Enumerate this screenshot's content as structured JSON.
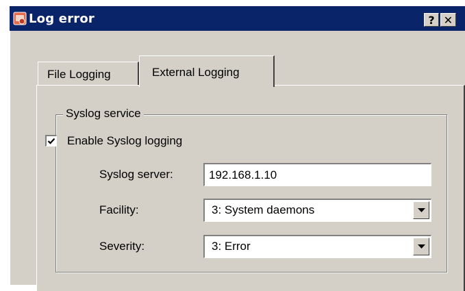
{
  "window": {
    "title": "Log error",
    "help_label": "?",
    "close_label": "✕"
  },
  "tabs": [
    {
      "label": "File Logging",
      "active": false
    },
    {
      "label": "External Logging",
      "active": true
    }
  ],
  "syslog": {
    "group_label": "Syslog service",
    "enable_label": "Enable Syslog logging",
    "enable_checked": true,
    "server_label": "Syslog server:",
    "server_value": "192.168.1.10",
    "facility_label": "Facility:",
    "facility_value": "3: System daemons",
    "severity_label": "Severity:",
    "severity_value": "3: Error"
  },
  "colors": {
    "titlebar": "#0a246a",
    "face": "#d4d0c8"
  },
  "icons": [
    "app-icon",
    "help-icon",
    "close-icon",
    "checkmark-icon",
    "dropdown-arrow-icon"
  ]
}
